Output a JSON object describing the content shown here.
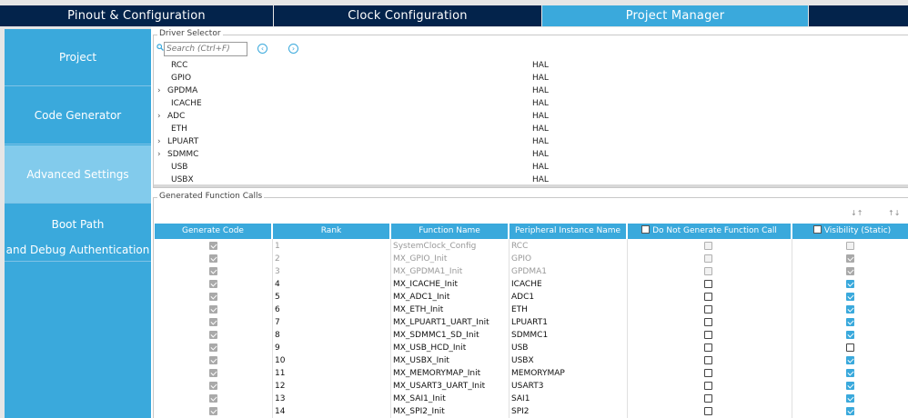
{
  "tabs": [
    {
      "label": "Pinout & Configuration",
      "active": false
    },
    {
      "label": "Clock Configuration",
      "active": false
    },
    {
      "label": "Project Manager",
      "active": true
    }
  ],
  "sidebar": {
    "items": [
      {
        "label": "Project"
      },
      {
        "label": "Code Generator"
      },
      {
        "label": "Advanced Settings",
        "active": true
      },
      {
        "label_line1": "Boot Path",
        "label_line2": "and Debug Authentication"
      }
    ]
  },
  "driver_selector": {
    "title": "Driver Selector",
    "search_placeholder": "Search (Ctrl+F)",
    "prev_icon": "circle-left-arrow-icon",
    "next_icon": "circle-right-arrow-icon",
    "rows": [
      {
        "name": "RCC",
        "value": "HAL",
        "expandable": false
      },
      {
        "name": "GPIO",
        "value": "HAL",
        "expandable": false
      },
      {
        "name": "GPDMA",
        "value": "HAL",
        "expandable": true
      },
      {
        "name": "ICACHE",
        "value": "HAL",
        "expandable": false
      },
      {
        "name": "ADC",
        "value": "HAL",
        "expandable": true
      },
      {
        "name": "ETH",
        "value": "HAL",
        "expandable": false
      },
      {
        "name": "LPUART",
        "value": "HAL",
        "expandable": true
      },
      {
        "name": "SDMMC",
        "value": "HAL",
        "expandable": true
      },
      {
        "name": "USB",
        "value": "HAL",
        "expandable": false
      },
      {
        "name": "USBX",
        "value": "HAL",
        "expandable": false
      }
    ]
  },
  "function_calls": {
    "title": "Generated Function Calls",
    "columns": {
      "generate": "Generate Code",
      "rank": "Rank",
      "function": "Function Name",
      "peripheral": "Peripheral Instance Name",
      "no_call": "Do Not Generate Function Call",
      "visibility": "Visibility (Static)"
    },
    "rows": [
      {
        "generate": true,
        "rank": "1",
        "function": "SystemClock_Config",
        "peripheral": "RCC",
        "no_call": false,
        "visibility": false,
        "disabled": true
      },
      {
        "generate": true,
        "rank": "2",
        "function": "MX_GPIO_Init",
        "peripheral": "GPIO",
        "no_call": false,
        "visibility": true,
        "disabled": true
      },
      {
        "generate": true,
        "rank": "3",
        "function": "MX_GPDMA1_Init",
        "peripheral": "GPDMA1",
        "no_call": false,
        "visibility": true,
        "disabled": true
      },
      {
        "generate": true,
        "rank": "4",
        "function": "MX_ICACHE_Init",
        "peripheral": "ICACHE",
        "no_call": false,
        "visibility": true,
        "disabled": false
      },
      {
        "generate": true,
        "rank": "5",
        "function": "MX_ADC1_Init",
        "peripheral": "ADC1",
        "no_call": false,
        "visibility": true,
        "disabled": false
      },
      {
        "generate": true,
        "rank": "6",
        "function": "MX_ETH_Init",
        "peripheral": "ETH",
        "no_call": false,
        "visibility": true,
        "disabled": false
      },
      {
        "generate": true,
        "rank": "7",
        "function": "MX_LPUART1_UART_Init",
        "peripheral": "LPUART1",
        "no_call": false,
        "visibility": true,
        "disabled": false
      },
      {
        "generate": true,
        "rank": "8",
        "function": "MX_SDMMC1_SD_Init",
        "peripheral": "SDMMC1",
        "no_call": false,
        "visibility": true,
        "disabled": false
      },
      {
        "generate": true,
        "rank": "9",
        "function": "MX_USB_HCD_Init",
        "peripheral": "USB",
        "no_call": false,
        "visibility": false,
        "disabled": false
      },
      {
        "generate": true,
        "rank": "10",
        "function": "MX_USBX_Init",
        "peripheral": "USBX",
        "no_call": false,
        "visibility": true,
        "disabled": false
      },
      {
        "generate": true,
        "rank": "11",
        "function": "MX_MEMORYMAP_Init",
        "peripheral": "MEMORYMAP",
        "no_call": false,
        "visibility": true,
        "disabled": false
      },
      {
        "generate": true,
        "rank": "12",
        "function": "MX_USART3_UART_Init",
        "peripheral": "USART3",
        "no_call": false,
        "visibility": true,
        "disabled": false
      },
      {
        "generate": true,
        "rank": "13",
        "function": "MX_SAI1_Init",
        "peripheral": "SAI1",
        "no_call": false,
        "visibility": true,
        "disabled": false
      },
      {
        "generate": true,
        "rank": "14",
        "function": "MX_SPI2_Init",
        "peripheral": "SPI2",
        "no_call": false,
        "visibility": true,
        "disabled": false
      }
    ]
  },
  "colors": {
    "accent": "#3aa9dc",
    "dark": "#03234b",
    "active_side": "#82cbec"
  }
}
